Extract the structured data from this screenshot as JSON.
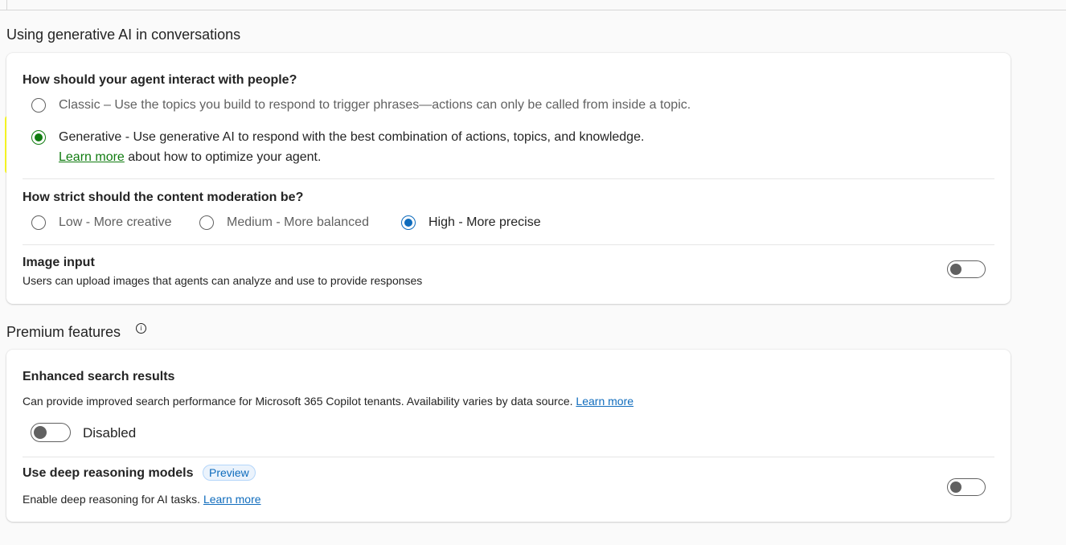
{
  "section1": {
    "title": "Using generative AI in conversations",
    "interaction": {
      "question": "How should your agent interact with people?",
      "classic": "Classic – Use the topics you build to respond to trigger phrases—actions can only be called from inside a topic.",
      "generative": "Generative - Use generative AI to respond with the best combination of actions, topics, and knowledge.",
      "learn_more": "Learn more",
      "learn_more_suffix": "about how to optimize your agent.",
      "selected": "generative"
    },
    "moderation": {
      "question": "How strict should the content moderation be?",
      "low": "Low - More creative",
      "medium": "Medium - More balanced",
      "high": "High - More precise",
      "selected": "high"
    },
    "image_input": {
      "title": "Image input",
      "description": "Users can upload images that agents can analyze and use to provide responses",
      "enabled": false
    }
  },
  "section2": {
    "title": "Premium features",
    "enhanced_search": {
      "title": "Enhanced search results",
      "description": "Can provide improved search performance for Microsoft 365 Copilot tenants. Availability varies by data source.",
      "learn_more": "Learn more",
      "toggle_label": "Disabled",
      "enabled": false
    },
    "deep_reasoning": {
      "title": "Use deep reasoning models",
      "badge": "Preview",
      "description": "Enable deep reasoning for AI tasks.",
      "learn_more": "Learn more",
      "enabled": false
    }
  },
  "colors": {
    "accent": "#0f6cbd",
    "generative_selected": "#107c10",
    "highlight": "#ffff00"
  },
  "icons": {
    "info": "info-icon"
  }
}
